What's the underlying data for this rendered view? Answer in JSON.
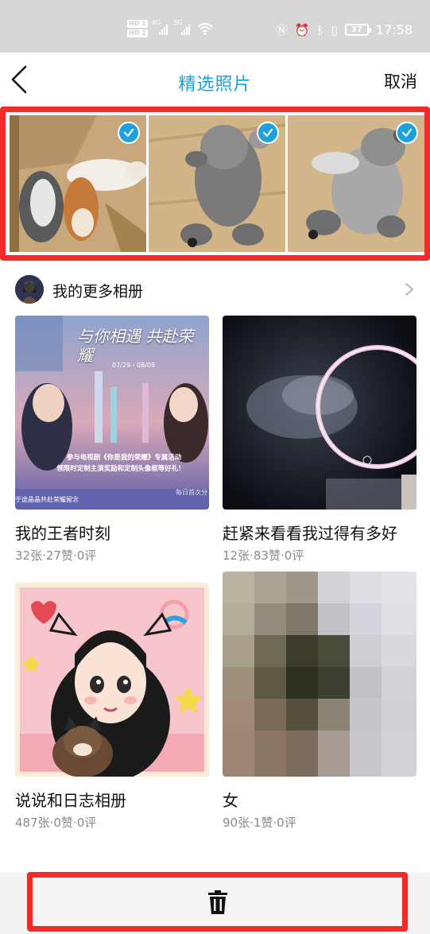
{
  "status_bar": {
    "hd1": "HD 1",
    "hd2": "HD 2",
    "net1": "4G",
    "net2": "5G",
    "battery": "37",
    "time": "17:58"
  },
  "header": {
    "title": "精选照片",
    "cancel_label": "取消"
  },
  "selected_photos": [
    {
      "name": "cats-and-dogs-on-rug",
      "checked": true
    },
    {
      "name": "grey-schnauzer-lying",
      "checked": true
    },
    {
      "name": "schnauzer-sleeping",
      "checked": true
    }
  ],
  "more_albums": {
    "label": "我的更多相册"
  },
  "albums": [
    {
      "name": "我的王者时刻",
      "stats": "32张·27赞·0评",
      "cover": {
        "headline": "与你相遇 共赴荣耀",
        "date": "07/29 - 08/08",
        "line1": "参与电视剧《你是我的荣耀》专属活动",
        "line2": "领限时定制主演奖励和定制头像框等好礼！",
        "footer_left": "于途晶晶共赴荣耀留念",
        "footer_right": "每日首次分"
      }
    },
    {
      "name": "赶紧来看看我过得有多好",
      "stats": "12张·83赞·0评"
    },
    {
      "name": "说说和日志相册",
      "stats": "487张·0赞·0评"
    },
    {
      "name": "女",
      "stats": "90张·1赞·0评"
    }
  ],
  "colors": {
    "accent": "#1aa1de",
    "highlight_border": "#f22a2a",
    "status_bar": "#d7d7d7",
    "meta_text": "#8a8a8a"
  },
  "icons": {
    "back": "chevron-left-icon",
    "check": "check-icon",
    "chevron": "chevron-right-icon",
    "delete": "trash-icon"
  }
}
